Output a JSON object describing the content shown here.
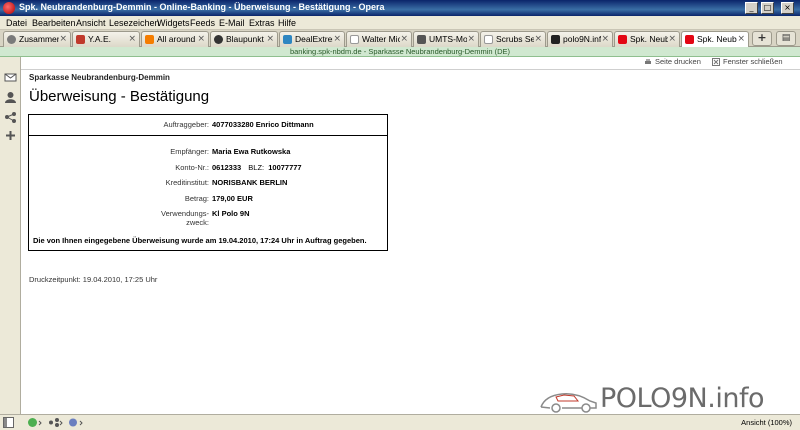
{
  "window": {
    "title": "Spk. Neubrandenburg-Demmin - Online-Banking - Überweisung - Bestätigung - Opera",
    "minimize": "_",
    "maximize": "□",
    "close": "×"
  },
  "menu": [
    "Datei",
    "Bearbeiten",
    "Ansicht",
    "Lesezeichen",
    "Widgets",
    "Feeds",
    "E-Mail",
    "Extras",
    "Hilfe"
  ],
  "tabs": [
    {
      "label": "Zusammen...",
      "icon": "gear-icon",
      "color": "#7a7a7a"
    },
    {
      "label": "Y.A.E.",
      "icon": "yae-icon",
      "color": "#c0392b"
    },
    {
      "label": "All around t...",
      "icon": "blogger-icon",
      "color": "#f57d00"
    },
    {
      "label": "Blaupunkt ...",
      "icon": "blaupunkt-icon",
      "color": "#333333"
    },
    {
      "label": "DealExtrem...",
      "icon": "dx-icon",
      "color": "#2e86c1"
    },
    {
      "label": "Walter Mic...",
      "icon": "page-icon",
      "color": "#bdbdbd"
    },
    {
      "label": "UMTS-Mo...",
      "icon": "umts-icon",
      "color": "#555555"
    },
    {
      "label": "Scrubs Se...",
      "icon": "page-icon",
      "color": "#bdbdbd"
    },
    {
      "label": "polo9N.inf...",
      "icon": "polo-icon",
      "color": "#222222"
    },
    {
      "label": "Spk. Neub...",
      "icon": "sparkasse-icon",
      "color": "#e30613"
    },
    {
      "label": "Spk. Neub...",
      "icon": "sparkasse-icon",
      "color": "#e30613"
    }
  ],
  "active_tab_index": 10,
  "new_tab": "+",
  "address": "banking.spk-nbdm.de - Sparkasse Neubrandenburg-Demmin (DE)",
  "page": {
    "print_link": "Seite drucken",
    "close_link": "Fenster schließen",
    "bank_name": "Sparkasse Neubrandenburg-Demmin",
    "title": "Überweisung - Bestätigung",
    "auftraggeber_label": "Auftraggeber:",
    "auftraggeber_value": "4077033280 Enrico Dittmann",
    "empfaenger_label": "Empfänger:",
    "empfaenger_value": "Maria Ewa Rutkowska",
    "konto_label": "Konto-Nr.:",
    "konto_value": "0612333",
    "blz_label": "BLZ:",
    "blz_value": "10077777",
    "institut_label": "Kreditinstitut:",
    "institut_value": "NORISBANK BERLIN",
    "betrag_label": "Betrag:",
    "betrag_value": "179,00 EUR",
    "zweck_label_1": "Verwendungs-",
    "zweck_label_2": "zweck:",
    "zweck_value": "Kl Polo 9N",
    "confirmation": "Die von Ihnen eingegebene Überweisung wurde am 19.04.2010, 17:24 Uhr in Auftrag gegeben.",
    "print_time": "Druckzeitpunkt: 19.04.2010, 17:25 Uhr"
  },
  "watermark": "POLO9N.info",
  "status": {
    "zoom": "Ansicht (100%)"
  }
}
